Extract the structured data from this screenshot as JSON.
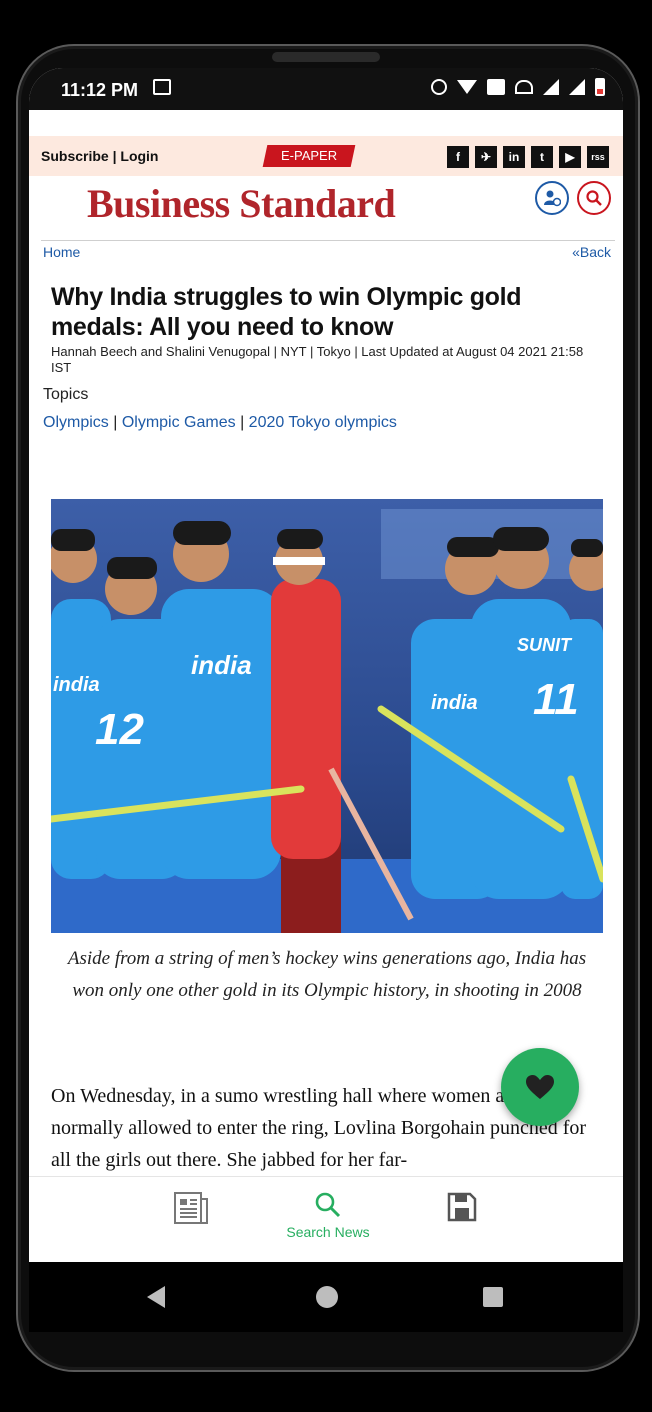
{
  "status": {
    "time": "11:12 PM"
  },
  "top": {
    "subscribe_login": "Subscribe | Login",
    "epaper": "E-PAPER",
    "social": [
      "f",
      "✈",
      "in",
      "t",
      "▶",
      "rss"
    ]
  },
  "brand": {
    "name": "Business Standard"
  },
  "breadcrumbs": {
    "home": "Home",
    "back": "«Back"
  },
  "article": {
    "headline": "Why India struggles to win Olympic gold medals: All you need to know",
    "byline": "Hannah Beech and Shalini Venugopal | NYT | Tokyo | Last Updated at August 04 2021 21:58 IST",
    "topics_label": "Topics",
    "topics": [
      "Olympics",
      "Olympic Games",
      "2020 Tokyo olympics"
    ],
    "caption": "Aside from a string of men’s hockey wins generations ago, India has won only one other gold in its Olympic history, in shooting in 2008",
    "body": "On Wednesday, in a sumo wrestling hall where women are not normally allowed to enter the ring, Lovlina Borgohain punched for all the girls out there. She jabbed for her far-"
  },
  "photo": {
    "jersey_text": "india",
    "number_left": "12",
    "number_right": "11",
    "player_name": "SUNIT"
  },
  "bottom_nav": {
    "search_label": "Search News"
  },
  "colors": {
    "brand": "#b0252b",
    "accent": "#27ae60",
    "link": "#1e5aa6"
  }
}
